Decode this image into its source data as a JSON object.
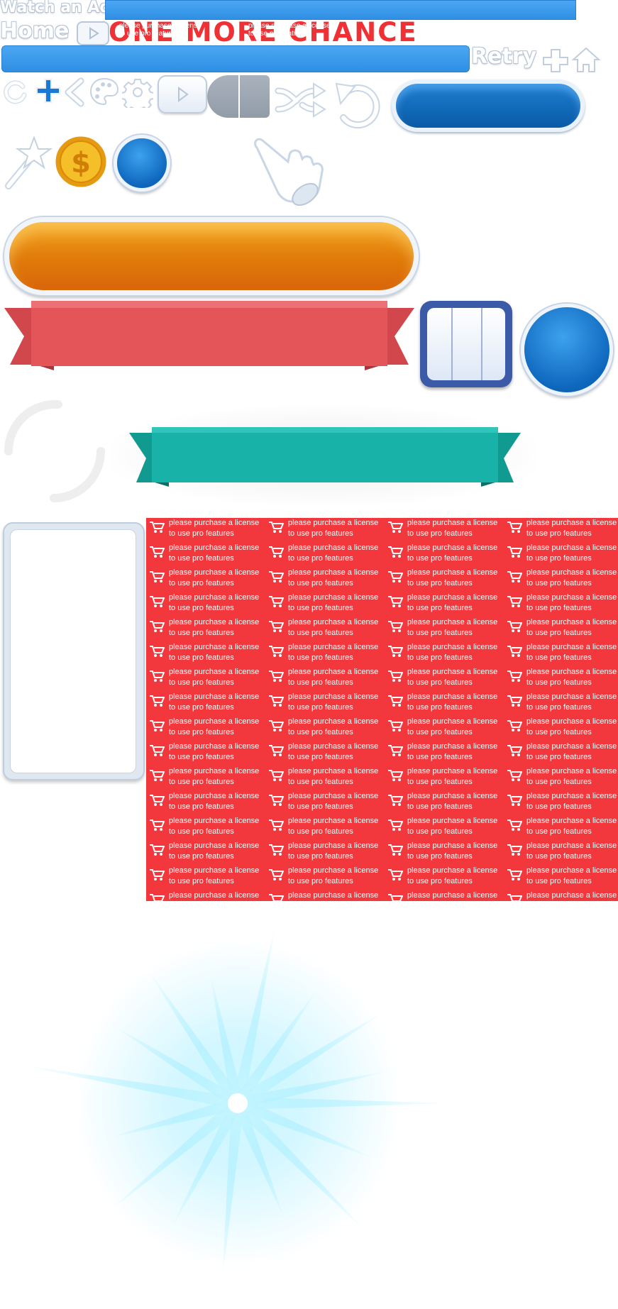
{
  "labels": {
    "watch_ad": "Watch an Ad",
    "home": "Home",
    "retry": "Retry",
    "title": "ONE MORE CHANCE"
  },
  "watermark": {
    "line1": "please purchase a license",
    "line2": "to use pro features",
    "rows": 16,
    "cols": 4
  },
  "colors": {
    "blue_bar": "#3a9bec",
    "title_red": "#ef3135",
    "orange_button": "#ee8f14",
    "red_ribbon": "#e4555a",
    "teal_ribbon": "#18b2a8",
    "coin_gold": "#f3b21c",
    "watermark_red": "#f2383c",
    "light_burst": "#5fe0ff"
  },
  "icons": {
    "row1": [
      "refresh-icon",
      "plus-icon",
      "back-icon",
      "palette-icon",
      "gear-icon",
      "play-icon",
      "toggle-icon",
      "shuffle-icon",
      "undo-icon"
    ],
    "row2": [
      "magic-wand-icon",
      "coin-icon",
      "pointer-hand-icon"
    ]
  }
}
